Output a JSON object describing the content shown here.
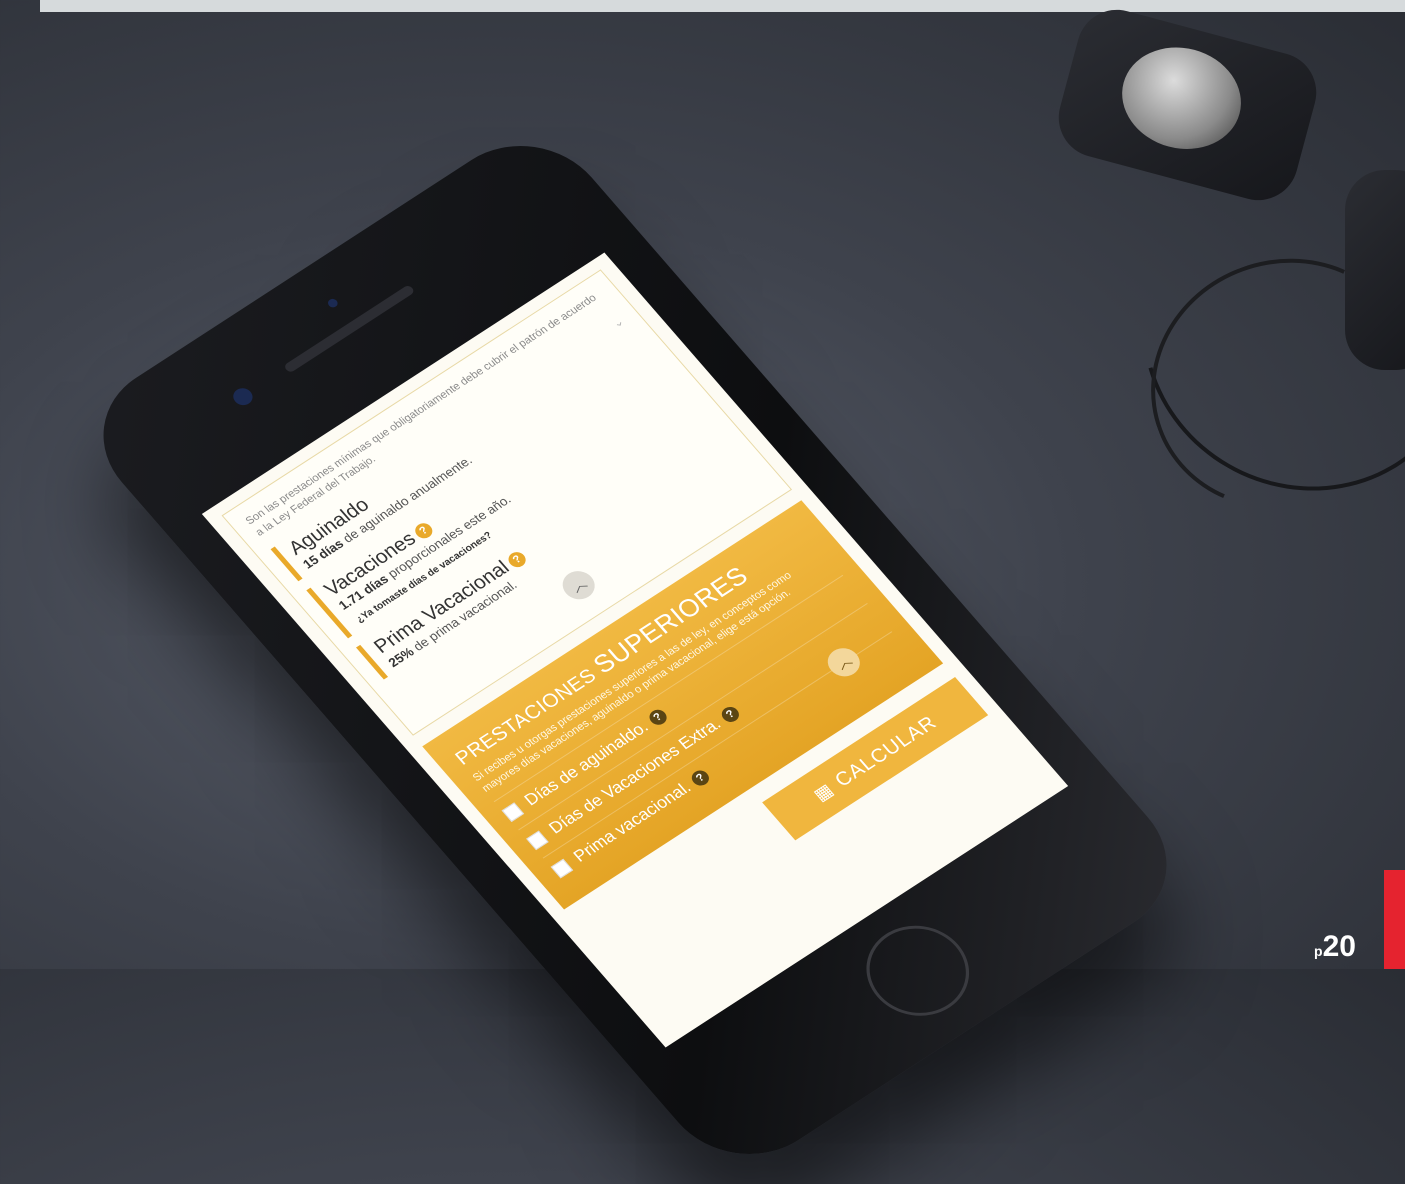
{
  "intro": "Son las prestaciones mínimas que obligatoriamente debe cubrir el patrón de acuerdo a la Ley Federal del Trabajo.",
  "items": [
    {
      "name": "Aguinaldo",
      "bold": "15 días",
      "rest": " de aguinaldo anualmente."
    },
    {
      "name": "Vacaciones",
      "bold": "1.71 días",
      "rest": " proporcionales este año."
    },
    {
      "name": "Prima Vacacional",
      "bold": "25%",
      "rest": " de prima vacacional."
    }
  ],
  "vacation_question": "¿Ya tomaste días de vacaciones?",
  "superiores": {
    "title_a": "PRESTACIONES ",
    "title_b": "SUPERIORES",
    "desc": "Si recibes u otorgas prestaciones superiores a las de ley, en conceptos como mayores días vacaciones, aguinaldo o prima vacacional, elige está opción.",
    "options": [
      "Días de aguinaldo.",
      "Días de Vacaciones Extra.",
      "Prima vacacional."
    ]
  },
  "calc_label": "CALCULAR",
  "page": {
    "prefix": "p",
    "number": "20"
  },
  "colors": {
    "accent": "#e9a92a",
    "badge": "#e5232f"
  }
}
